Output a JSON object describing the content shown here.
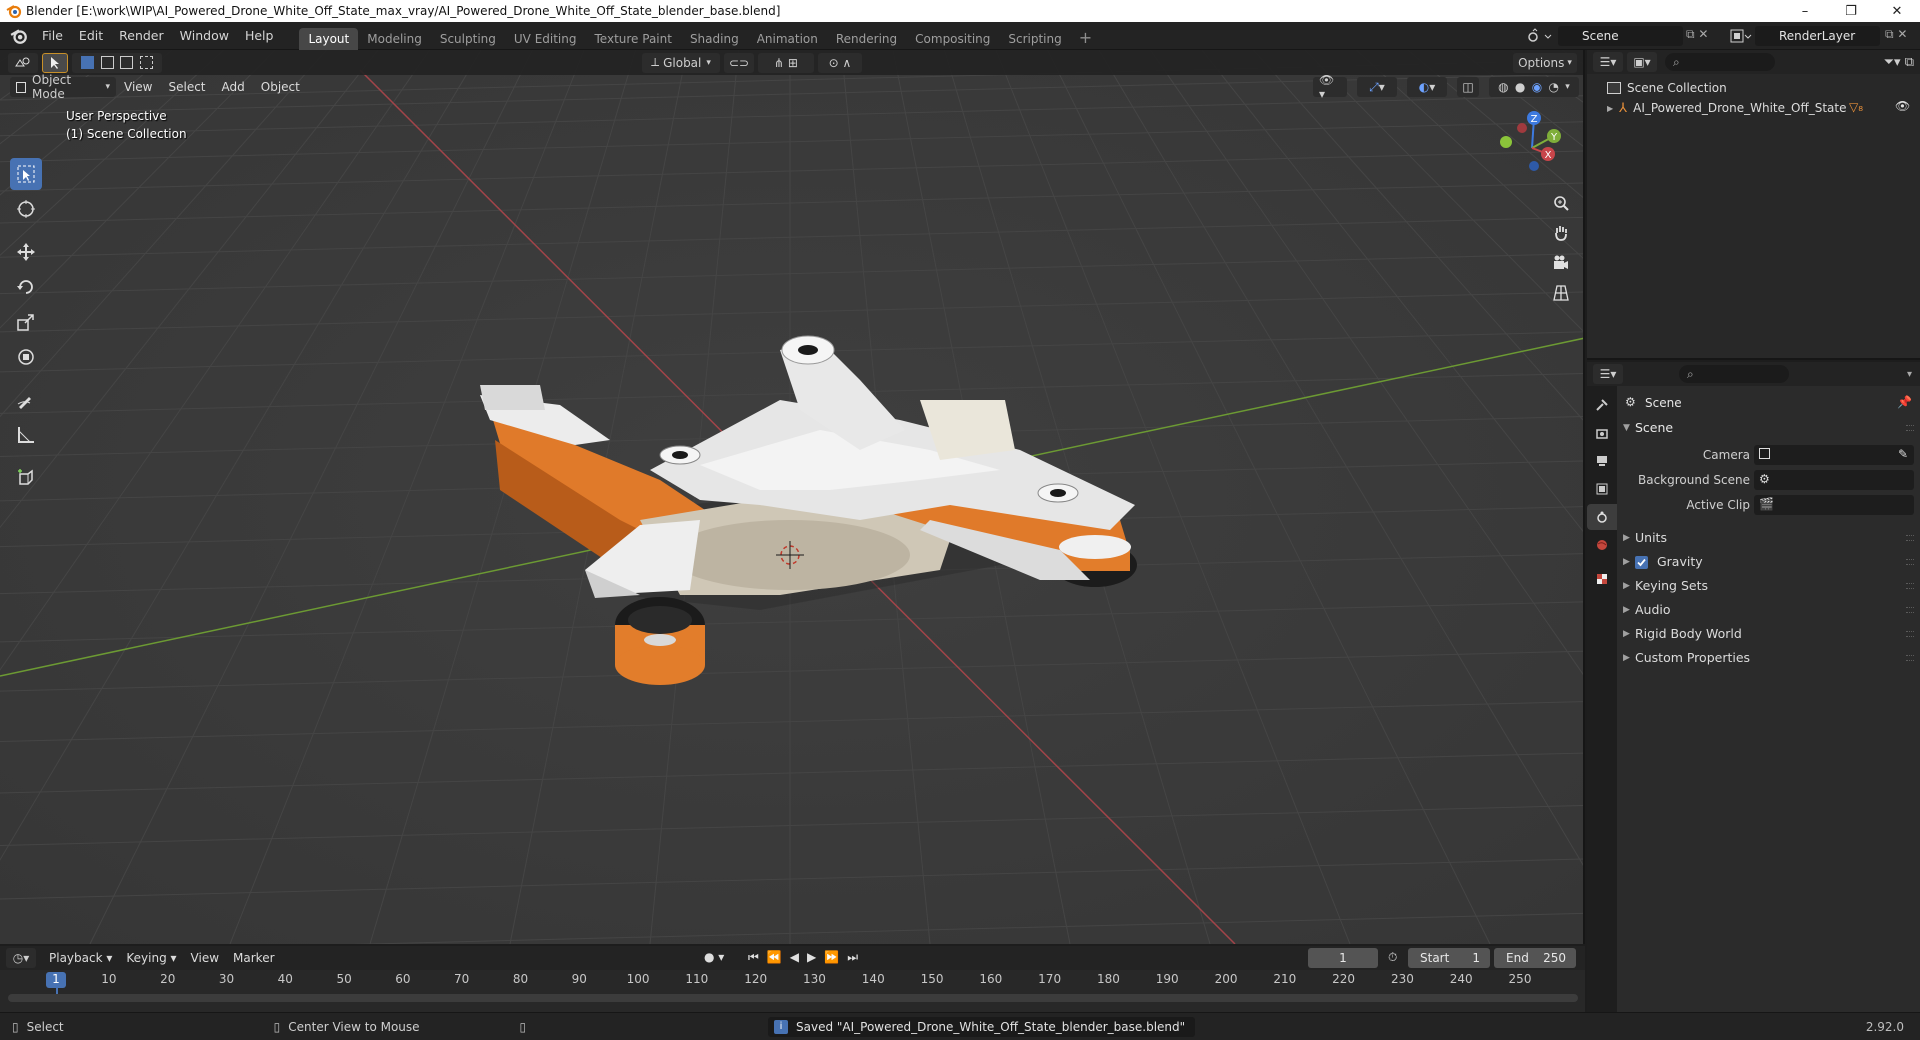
{
  "window": {
    "title": "Blender [E:\\work\\WIP\\AI_Powered_Drone_White_Off_State_max_vray/AI_Powered_Drone_White_Off_State_blender_base.blend]",
    "controls": [
      "–",
      "❐",
      "✕"
    ]
  },
  "menus": [
    "File",
    "Edit",
    "Render",
    "Window",
    "Help"
  ],
  "workspaces": [
    "Layout",
    "Modeling",
    "Sculpting",
    "UV Editing",
    "Texture Paint",
    "Shading",
    "Animation",
    "Rendering",
    "Compositing",
    "Scripting"
  ],
  "active_workspace": "Layout",
  "scene_name": "Scene",
  "view_layer": "RenderLayer",
  "viewport": {
    "transform_orientation": "Global",
    "options_label": "Options",
    "mode": "Object Mode",
    "header_menus": [
      "View",
      "Select",
      "Add",
      "Object"
    ],
    "overlay_title": "User Perspective",
    "overlay_subtitle": "(1) Scene Collection",
    "gizmo_axes": {
      "z": "Z",
      "y": "Y",
      "x": "X"
    }
  },
  "outliner": {
    "root": "Scene Collection",
    "items": [
      {
        "name": "AI_Powered_Drone_White_Off_State"
      }
    ]
  },
  "properties": {
    "context_title": "Scene",
    "panel_scene": "Scene",
    "fields": [
      {
        "label": "Camera",
        "value": ""
      },
      {
        "label": "Background Scene",
        "value": ""
      },
      {
        "label": "Active Clip",
        "value": ""
      }
    ],
    "panels": [
      "Units",
      "Gravity",
      "Keying Sets",
      "Audio",
      "Rigid Body World",
      "Custom Properties"
    ],
    "gravity_checked": true
  },
  "timeline": {
    "menus": [
      "Playback",
      "Keying",
      "View",
      "Marker"
    ],
    "current_frame": "1",
    "start_label": "Start",
    "start_value": "1",
    "end_label": "End",
    "end_value": "250",
    "ruler": [
      "1",
      "10",
      "20",
      "30",
      "40",
      "50",
      "60",
      "70",
      "80",
      "90",
      "100",
      "110",
      "120",
      "130",
      "140",
      "150",
      "160",
      "170",
      "180",
      "190",
      "200",
      "210",
      "220",
      "230",
      "240",
      "250"
    ]
  },
  "statusbar": {
    "select": "Select",
    "center_view": "Center View to Mouse",
    "message": "Saved \"AI_Powered_Drone_White_Off_State_blender_base.blend\"",
    "version": "2.92.0"
  },
  "colors": {
    "accent": "#4772b3",
    "drone_orange": "#f07f2c",
    "x_axis": "#c8454a",
    "y_axis": "#7fae3a",
    "z_axis": "#3d7ae0"
  }
}
